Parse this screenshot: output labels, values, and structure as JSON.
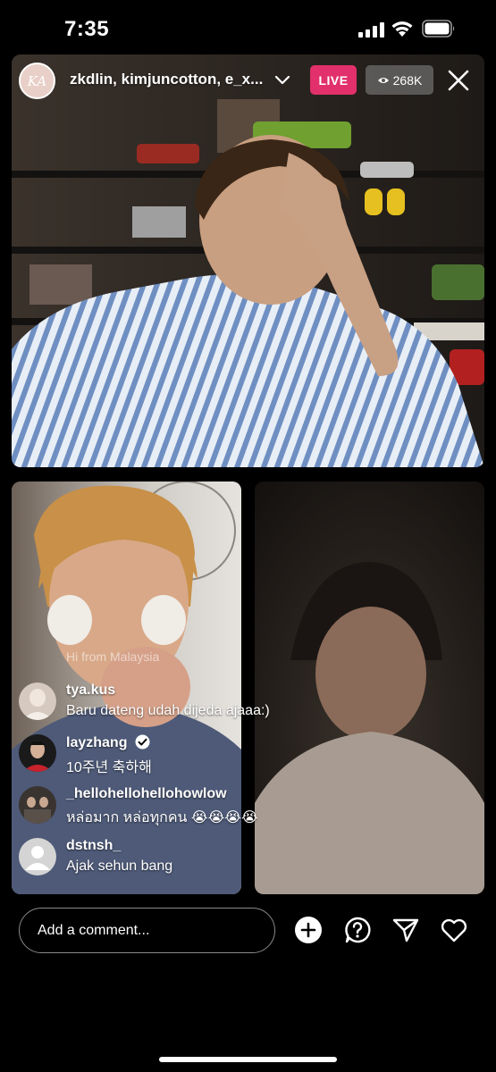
{
  "status_bar": {
    "time": "7:35"
  },
  "live": {
    "host_avatar_text": "KA",
    "host_names": "zkdlin, kimjuncotton, e_x...",
    "live_label": "LIVE",
    "viewer_count": "268K"
  },
  "comments": {
    "overlay_text": "Hi from Malaysia",
    "items": [
      {
        "user": "tya.kus",
        "text": "Baru dateng udah dijeda ajaaa:)"
      },
      {
        "user": "layzhang",
        "text": "10주년 축하해",
        "verified": true
      },
      {
        "user": "_hellohellohellohowlow",
        "text": "หล่อมาก หล่อทุกคน 😭😭😭😭"
      },
      {
        "user": "dstnsh_",
        "text": "Ajak sehun bang"
      }
    ]
  },
  "bottom_bar": {
    "comment_placeholder": "Add a comment..."
  },
  "colors": {
    "live_badge": "#e1306c",
    "background": "#000000"
  }
}
